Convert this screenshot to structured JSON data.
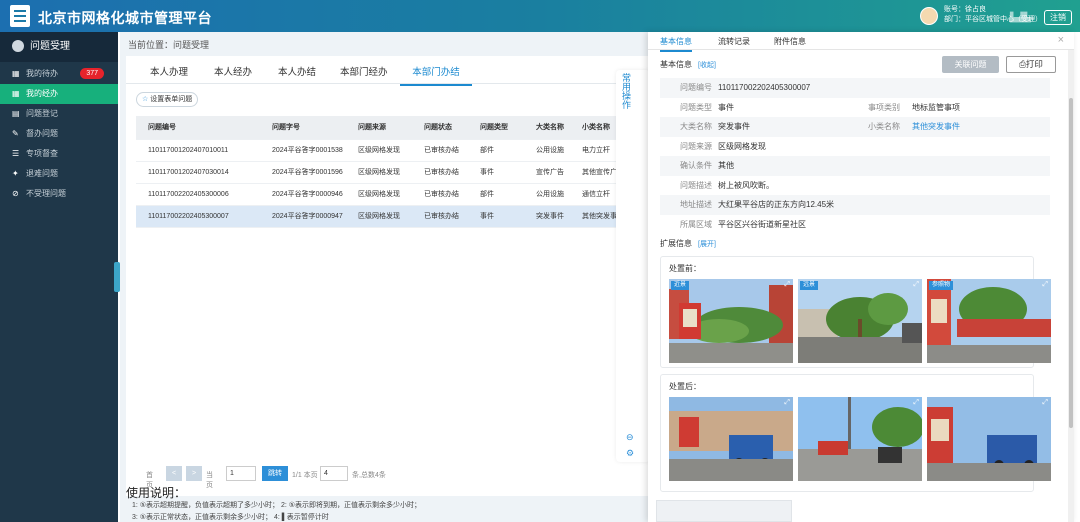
{
  "header": {
    "title": "北京市网格化城市管理平台",
    "account_line": "账号：徐占良",
    "dept_line": "部门：平谷区城管中心（受理）",
    "logout": "注销"
  },
  "sidebar": {
    "header": "问题受理",
    "items": [
      {
        "label": "我的待办",
        "icon": "grid-icon",
        "badge": "377"
      },
      {
        "label": "我的经办",
        "icon": "grid-icon",
        "active": true
      },
      {
        "label": "问题登记",
        "icon": "form-icon"
      },
      {
        "label": "督办问题",
        "icon": "pen-icon"
      },
      {
        "label": "专项督查",
        "icon": "checklist-icon"
      },
      {
        "label": "退难问题",
        "icon": "wrench-icon"
      },
      {
        "label": "不受理问题",
        "icon": "ban-icon"
      }
    ]
  },
  "breadcrumb": "当前位置：问题受理",
  "tabs": [
    "本人办理",
    "本人经办",
    "本人办结",
    "本部门经办",
    "本部门办结"
  ],
  "filter_button": "设置表单问题",
  "table": {
    "headers": [
      "问题编号",
      "问题字号",
      "问题来源",
      "问题状态",
      "问题类型",
      "大类名称",
      "小类名称"
    ],
    "rows": [
      [
        "110117001202407010011",
        "2024平谷答字0001538",
        "区级网格发现",
        "已审核办结",
        "部件",
        "公用设施",
        "电力立杆"
      ],
      [
        "110117001202407030014",
        "2024平谷答字0001596",
        "区级网格发现",
        "已审核办结",
        "事件",
        "宣传广告",
        "其他宣传广告"
      ],
      [
        "110117002202405300006",
        "2024平谷答字0000946",
        "区级网格发现",
        "已审核办结",
        "部件",
        "公用设施",
        "通信立杆"
      ],
      [
        "110117002202405300007",
        "2024平谷答字0000947",
        "区级网格发现",
        "已审核办结",
        "事件",
        "突发事件",
        "其他突发事件"
      ]
    ]
  },
  "pager": {
    "first": "首页",
    "prev": "<",
    "next": ">",
    "page_label": "当页",
    "page_value": "1",
    "jump": "跳转",
    "page_count": "1/1 本页",
    "per_page": "4",
    "total": "条,总数4条"
  },
  "usage": {
    "title": "使用说明：",
    "line1": "1:  ⑤表示超期提醒，负值表示超期了多少小时；  2:  ⑤表示即将到期，正值表示剩余多少小时；",
    "line2": "3:  ⑤表示正常状态，正值表示剩余多少小时；  4:  ▌表示暂停计时"
  },
  "side_float": {
    "label": "常用操作"
  },
  "detail": {
    "tabs": [
      "基本信息",
      "流转记录",
      "附件信息"
    ],
    "close": "×",
    "basic_title": "基本信息",
    "collapse": "[收起]",
    "related_button": "关联问题",
    "print_button": "打印",
    "fields": {
      "id_label": "问题编号",
      "id": "110117002202405300007",
      "type_label": "问题类型",
      "type": "事件",
      "category_label": "事项类别",
      "category": "地标监管事项",
      "major_label": "大类名称",
      "major": "突发事件",
      "minor_label": "小类名称",
      "minor": "其他突发事件",
      "source_label": "问题来源",
      "source": "区级网格发现",
      "cond_label": "确认条件",
      "cond": "其他",
      "desc_label": "问题描述",
      "desc": "树上被风吹断。",
      "addr_label": "地址描述",
      "addr": "大红果平谷店的正东方向12.45米",
      "area_label": "所属区域",
      "area": "平谷区兴谷街道新星社区"
    },
    "ext_title": "扩展信息",
    "expand": "[展开]",
    "before_label": "处置前：",
    "after_label": "处置后：",
    "before_tags": [
      "近景",
      "远景",
      "参照物"
    ]
  }
}
